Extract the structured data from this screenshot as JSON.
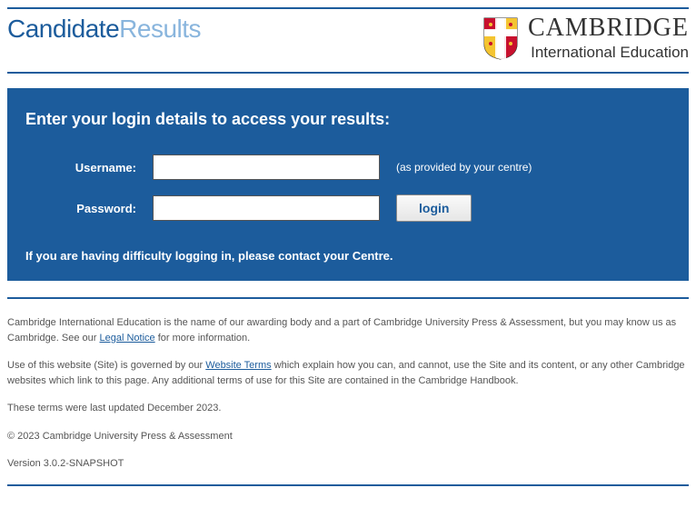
{
  "header": {
    "brand_part1": "Candidate",
    "brand_part2": "Results",
    "cambridge_name": "CAMBRIDGE",
    "cambridge_sub": "International Education"
  },
  "login": {
    "heading": "Enter your login details to access your results:",
    "username_label": "Username:",
    "username_hint": "(as provided by your centre)",
    "password_label": "Password:",
    "button_label": "login",
    "help_text": "If you are having difficulty logging in, please contact your Centre."
  },
  "footer": {
    "p1_a": "Cambridge International Education is the name of our awarding body and a part of Cambridge University Press & Assessment, but you may know us as Cambridge. See our ",
    "p1_link": "Legal Notice",
    "p1_b": " for more information.",
    "p2_a": "Use of this website (Site) is governed by our ",
    "p2_link": "Website Terms",
    "p2_b": " which explain how you can, and cannot, use the Site and its content, or any other Cambridge websites which link to this page. Any additional terms of use for this Site are contained in the Cambridge Handbook.",
    "p3": "These terms were last updated December 2023.",
    "p4": "© 2023 Cambridge University Press & Assessment",
    "p5": "Version 3.0.2-SNAPSHOT"
  }
}
